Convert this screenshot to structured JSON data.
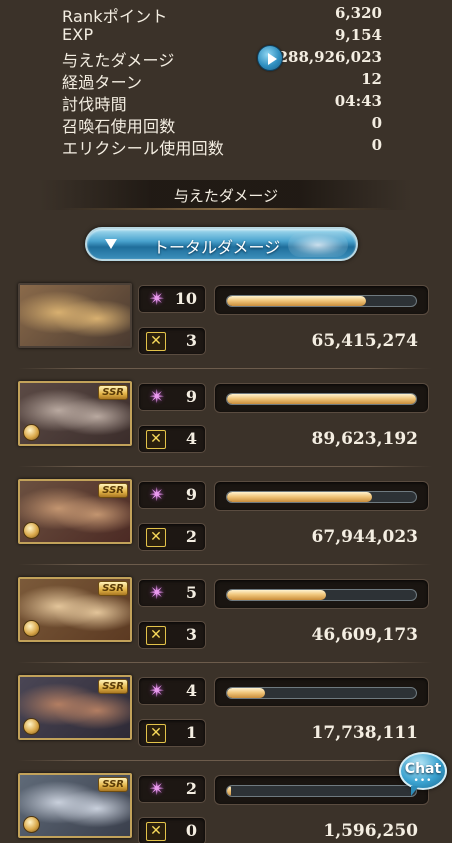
{
  "stats": {
    "rows": [
      {
        "label": "Rankポイント",
        "value": "6,320"
      },
      {
        "label": "EXP",
        "value": "9,154"
      },
      {
        "label": "与えたダメージ",
        "value": "288,926,023"
      },
      {
        "label": "経過ターン",
        "value": "12"
      },
      {
        "label": "討伐時間",
        "value": "04:43"
      },
      {
        "label": "召喚石使用回数",
        "value": "0"
      },
      {
        "label": "エリクシール使用回数",
        "value": "0"
      }
    ]
  },
  "section": {
    "heading": "与えたダメージ"
  },
  "total_button": {
    "label": "トータルダメージ"
  },
  "characters": [
    {
      "rarity": "",
      "attack_count": "10",
      "ability_count": "3",
      "damage": "65,415,274",
      "damage_fraction": 0.73,
      "portrait_colors": [
        "#8a6a4a",
        "#d8b070",
        "#4a3a30"
      ]
    },
    {
      "rarity": "SSR",
      "attack_count": "9",
      "ability_count": "4",
      "damage": "89,623,192",
      "damage_fraction": 1.0,
      "portrait_colors": [
        "#5b4a45",
        "#b9a9a0",
        "#3b2d2b"
      ]
    },
    {
      "rarity": "SSR",
      "attack_count": "9",
      "ability_count": "2",
      "damage": "67,944,023",
      "damage_fraction": 0.76,
      "portrait_colors": [
        "#6b5040",
        "#c39570",
        "#4c2a24"
      ]
    },
    {
      "rarity": "SSR",
      "attack_count": "5",
      "ability_count": "3",
      "damage": "46,609,173",
      "damage_fraction": 0.52,
      "portrait_colors": [
        "#7b5a3a",
        "#e3c59a",
        "#5c3a22"
      ]
    },
    {
      "rarity": "SSR",
      "attack_count": "4",
      "ability_count": "1",
      "damage": "17,738,111",
      "damage_fraction": 0.2,
      "portrait_colors": [
        "#4a4655",
        "#b37e62",
        "#2e2a36"
      ]
    },
    {
      "rarity": "SSR",
      "attack_count": "2",
      "ability_count": "0",
      "damage": "1,596,250",
      "damage_fraction": 0.02,
      "portrait_colors": [
        "#5f6a78",
        "#c9d0dc",
        "#3a3f4c"
      ]
    }
  ],
  "chat": {
    "label": "Chat",
    "dots": "•••"
  },
  "colors": {
    "background": "#3b3229",
    "bar_gold": "#f1c77d",
    "accent_blue": "#3aa2d0",
    "attack_pink": "#e99aee",
    "ability_yellow": "#f7d95a"
  },
  "icons": {
    "attack": "sparkle-icon",
    "ability": "ability-icon",
    "element": "element-icon",
    "play": "play-icon"
  }
}
